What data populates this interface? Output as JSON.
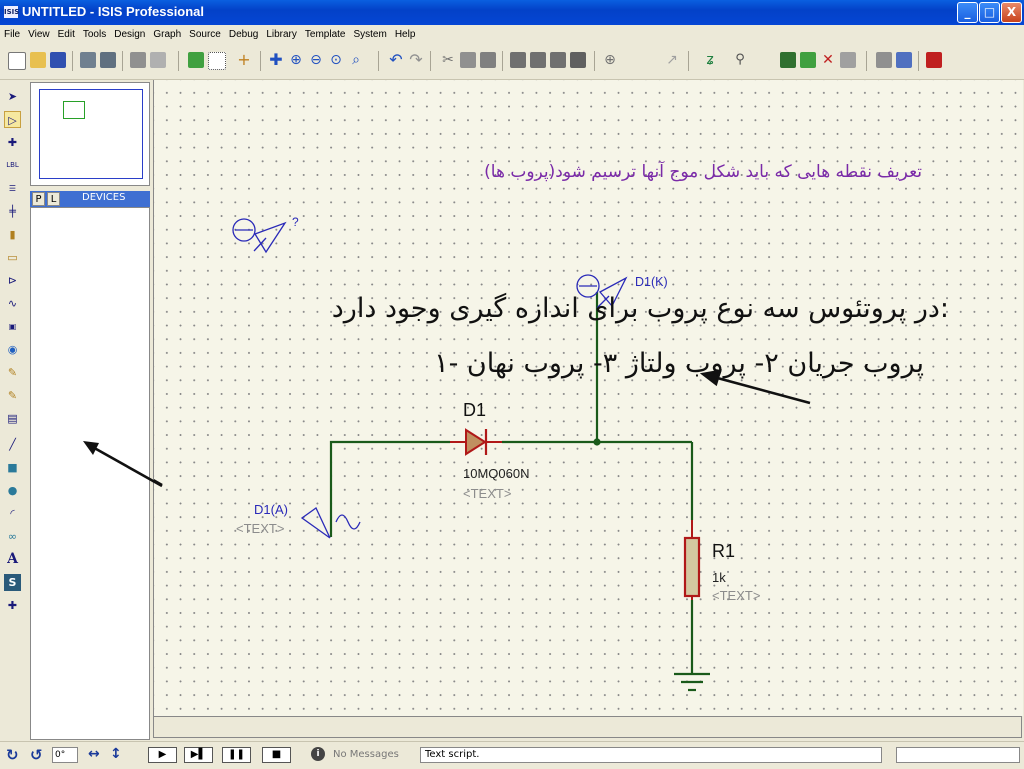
{
  "window": {
    "title": "UNTITLED - ISIS Professional",
    "app_icon": "ISIS"
  },
  "window_buttons": {
    "minimize": "_",
    "maximize": "□",
    "close": "X"
  },
  "menu": [
    "File",
    "View",
    "Edit",
    "Tools",
    "Design",
    "Graph",
    "Source",
    "Debug",
    "Library",
    "Template",
    "System",
    "Help"
  ],
  "left_panel": {
    "tabs": [
      "P",
      "L"
    ],
    "header_label": "DEVICES"
  },
  "schematic": {
    "caption": "تعریف نقطه هایی که باید شکل موج آنها ترسیم شود(پروب ها)",
    "body_line1": "در پروتئوس سه نوع پروب برای اندازه گیری وجود دارد:",
    "body_line2": "۱- پروب جریان   ۲- پروب ولتاژ   ۳- پروب نهان",
    "probe_query": "?",
    "probe_k_label": "D1(K)",
    "probe_a_label": "D1(A)",
    "probe_a_text": "<TEXT>",
    "diode": {
      "ref": "D1",
      "part": "10MQ060N",
      "text": "<TEXT>"
    },
    "resistor": {
      "ref": "R1",
      "value": "1k",
      "text": "<TEXT>"
    },
    "colors": {
      "wire": "#1a5a1a",
      "component": "#b01818",
      "resistor_fill": "#d4c8a0",
      "caption": "#7a2aa8",
      "probe_label": "#2a2ab8",
      "hidden_text": "#8c8c8c"
    }
  },
  "status": {
    "rotation": "0°",
    "messages": "No Messages",
    "script": "Text script."
  }
}
